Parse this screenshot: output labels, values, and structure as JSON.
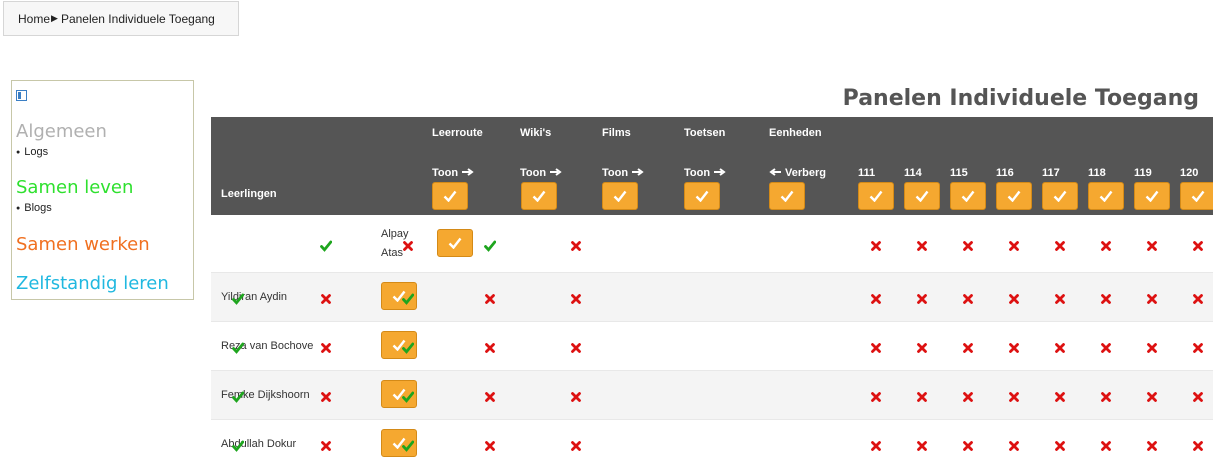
{
  "breadcrumb": {
    "home": "Home",
    "separator": "▶",
    "current": "Panelen Individuele Toegang"
  },
  "sidebar": {
    "toggle_icon": "sidebar-toggle-icon",
    "sections": [
      {
        "label": "Algemeen",
        "color": "#b0b0b0",
        "items": [
          "Logs"
        ]
      },
      {
        "label": "Samen leven",
        "color": "#2ee02e",
        "items": [
          "Blogs"
        ]
      },
      {
        "label": "Samen werken",
        "color": "#f07020",
        "items": []
      },
      {
        "label": "Zelfstandig leren",
        "color": "#20b8e0",
        "items": []
      }
    ]
  },
  "page_title": "Panelen Individuele Toegang",
  "table": {
    "students_header": "Leerlingen",
    "panels": [
      {
        "label": "Leerroute",
        "action": "Toon",
        "dir": "right"
      },
      {
        "label": "Wiki's",
        "action": "Toon",
        "dir": "right"
      },
      {
        "label": "Films",
        "action": "Toon",
        "dir": "right"
      },
      {
        "label": "Toetsen",
        "action": "Toon",
        "dir": "right"
      },
      {
        "label": "Eenheden",
        "action": "Verberg",
        "dir": "left"
      }
    ],
    "units": [
      "111",
      "114",
      "115",
      "116",
      "117",
      "118",
      "119",
      "120"
    ],
    "rows": [
      {
        "name_line1": "Alpay",
        "name_line2": "Atas",
        "panels": [
          true,
          true,
          false,
          true,
          false
        ],
        "units": [
          false,
          false,
          false,
          false,
          false,
          false,
          false,
          false
        ]
      },
      {
        "name_line1": "Yildiran Aydin",
        "name_line2": "",
        "panels": [
          true,
          false,
          true,
          false,
          false
        ],
        "units": [
          false,
          false,
          false,
          false,
          false,
          false,
          false,
          false
        ]
      },
      {
        "name_line1": "Reza van Bochove",
        "name_line2": "",
        "panels": [
          true,
          false,
          true,
          false,
          false
        ],
        "units": [
          false,
          false,
          false,
          false,
          false,
          false,
          false,
          false
        ]
      },
      {
        "name_line1": "Femke Dijkshoorn",
        "name_line2": "",
        "panels": [
          true,
          false,
          true,
          false,
          false
        ],
        "units": [
          false,
          false,
          false,
          false,
          false,
          false,
          false,
          false
        ]
      },
      {
        "name_line1": "Abdullah Dokur",
        "name_line2": "",
        "panels": [
          true,
          false,
          true,
          false,
          false
        ],
        "units": [
          false,
          false,
          false,
          false,
          false,
          false,
          false,
          false
        ]
      }
    ]
  },
  "colors": {
    "header_bg": "#555555",
    "button": "#f5a830",
    "check": "#1ea51e",
    "cross": "#dd1111"
  }
}
